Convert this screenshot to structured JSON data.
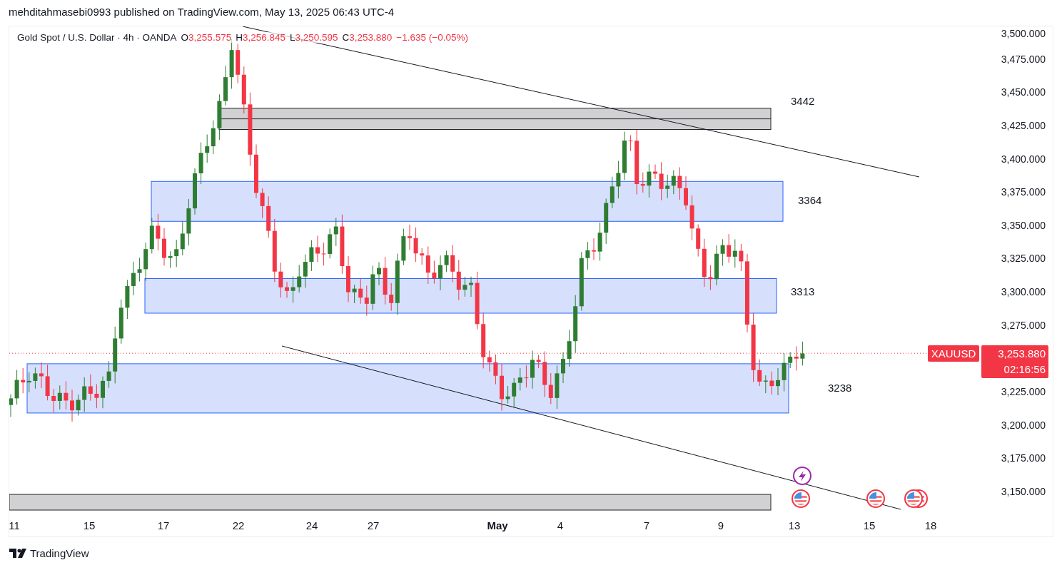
{
  "header": {
    "text": "mehditahmasebi0993 published on TradingView.com, May 13, 2025 06:43 UTC-4"
  },
  "legend": {
    "title": "Gold Spot / U.S. Dollar · 4h · OANDA",
    "values": [
      {
        "label": "O",
        "value": "3,255.575"
      },
      {
        "label": "H",
        "value": "3,256.845"
      },
      {
        "label": "L",
        "value": "3,250.595"
      },
      {
        "label": "C",
        "value": "3,253.880"
      }
    ],
    "change": "−1.635 (−0.05%)"
  },
  "price_axis": [
    "3,500.000",
    "3,475.000",
    "3,450.000",
    "3,425.000",
    "3,400.000",
    "3,375.000",
    "3,350.000",
    "3,325.000",
    "3,300.000",
    "3,275.000",
    "3,225.000",
    "3,200.000",
    "3,175.000",
    "3,150.000"
  ],
  "time_axis": [
    {
      "label": "11",
      "kind": "day"
    },
    {
      "label": "15",
      "kind": "day"
    },
    {
      "label": "17",
      "kind": "day"
    },
    {
      "label": "22",
      "kind": "day"
    },
    {
      "label": "24",
      "kind": "day"
    },
    {
      "label": "27",
      "kind": "day"
    },
    {
      "label": "May",
      "kind": "month"
    },
    {
      "label": "4",
      "kind": "day"
    },
    {
      "label": "7",
      "kind": "day"
    },
    {
      "label": "9",
      "kind": "day"
    },
    {
      "label": "13",
      "kind": "day"
    },
    {
      "label": "15",
      "kind": "day"
    },
    {
      "label": "18",
      "kind": "day"
    }
  ],
  "zones": [
    {
      "label": "3442",
      "kind": "grey"
    },
    {
      "label": "3364",
      "kind": "blue"
    },
    {
      "label": "3313",
      "kind": "blue"
    },
    {
      "label": "3238",
      "kind": "blue"
    }
  ],
  "price_tag": {
    "symbol": "XAUUSD",
    "price": "3,253.880",
    "countdown": "02:16:56"
  },
  "footer": {
    "logo": "TradingView"
  }
}
